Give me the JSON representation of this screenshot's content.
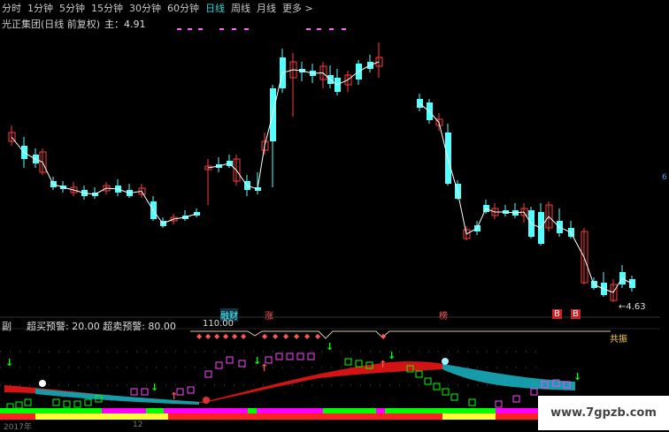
{
  "toolbar": {
    "tabs": [
      {
        "label": "分时",
        "active": false
      },
      {
        "label": "1分钟",
        "active": false
      },
      {
        "label": "5分钟",
        "active": false
      },
      {
        "label": "15分钟",
        "active": false
      },
      {
        "label": "30分钟",
        "active": false
      },
      {
        "label": "60分钟",
        "active": false
      },
      {
        "label": "日线",
        "active": true
      },
      {
        "label": "周线",
        "active": false
      },
      {
        "label": "月线",
        "active": false
      },
      {
        "label": "更多 >",
        "active": false
      }
    ]
  },
  "chart_header": {
    "title": "光正集团(日线 前复权)",
    "main_label": "主：4.91"
  },
  "price_annotation": "←4.63",
  "badges": {
    "b1": "融财",
    "b2": "涨",
    "b3": "榜",
    "b4": "B",
    "b5": "B"
  },
  "sub_panel": {
    "pane_label": "副",
    "indicator_text": "超买预警: 20.00  超卖预警: 80.00",
    "value": "110.00",
    "resonance_label": "共振"
  },
  "axis": {
    "date_1": "2017年",
    "date_2": "12",
    "right_tick": "6"
  },
  "watermark": "www.7gpzb.com",
  "colors": {
    "up": "#ff3b3b",
    "down": "#54ffff",
    "ma": "#ffffff",
    "accent_cyan": "#33d3d3",
    "magenta": "#ff00ff",
    "green": "#00ff00",
    "yellow": "#ffff33"
  }
}
